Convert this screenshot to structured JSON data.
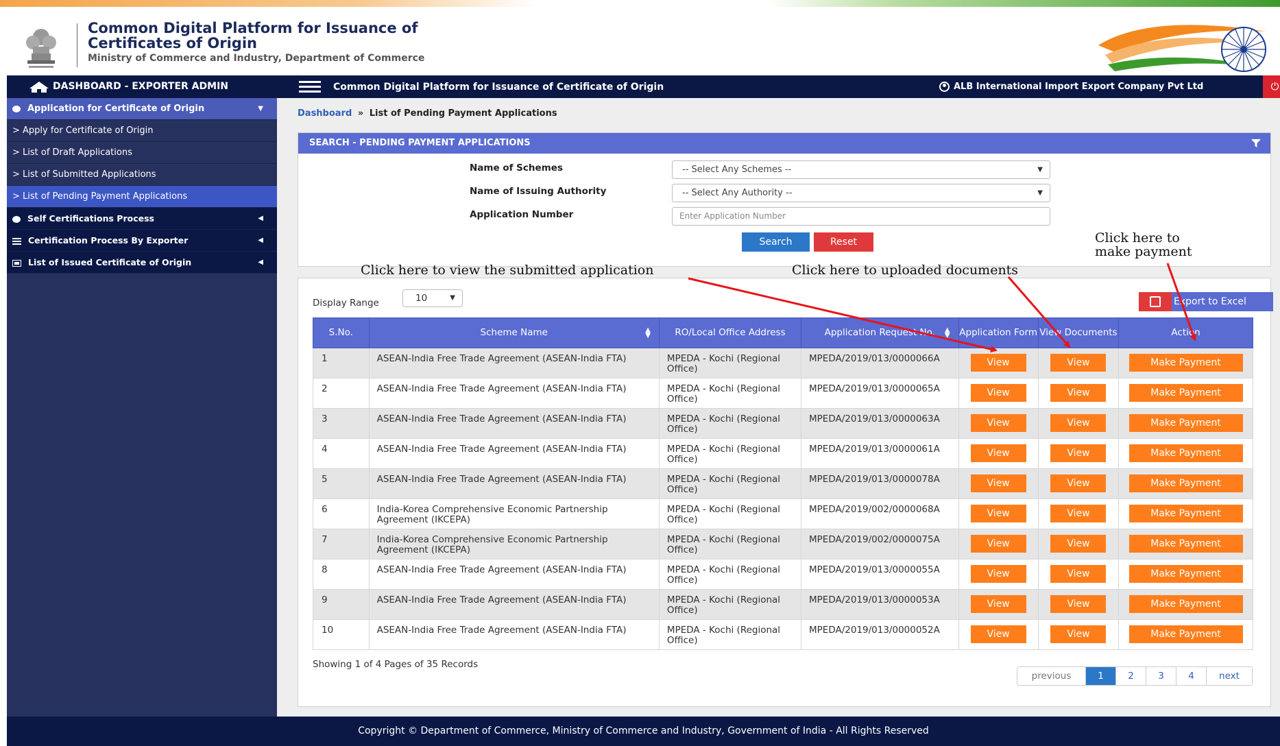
{
  "header": {
    "title_line1": "Common Digital Platform for Issuance of",
    "title_line2": "Certificates of Origin",
    "subtitle": "Ministry of Commerce and Industry, Department of Commerce"
  },
  "nav": {
    "brand": "DASHBOARD - EXPORTER ADMIN",
    "title": "Common Digital Platform for Issuance of Certificate of Origin",
    "user": "ALB International Import Export Company Pvt Ltd"
  },
  "sidebar": {
    "items": [
      {
        "label": "Application for Certificate of Origin"
      },
      {
        "label": "> Apply for Certificate of Origin"
      },
      {
        "label": "> List of Draft Applications"
      },
      {
        "label": "> List of Submitted Applications"
      },
      {
        "label": "> List of Pending Payment Applications"
      },
      {
        "label": "Self Certifications Process"
      },
      {
        "label": "Certification Process By Exporter"
      },
      {
        "label": "List of Issued Certificate of Origin"
      }
    ]
  },
  "breadcrumb": {
    "home": "Dashboard",
    "sep": "»",
    "current": "List of Pending Payment Applications"
  },
  "search": {
    "title": "SEARCH - PENDING PAYMENT APPLICATIONS",
    "scheme_label": "Name of Schemes",
    "scheme_value": "-- Select Any Schemes --",
    "authority_label": "Name of Issuing Authority",
    "authority_value": "-- Select Any Authority --",
    "appno_label": "Application Number",
    "appno_placeholder": "Enter Application Number",
    "search_btn": "Search",
    "reset_btn": "Reset"
  },
  "list": {
    "display_range_label": "Display Range",
    "display_range_value": "10",
    "export_btn": "Export to Excel",
    "columns": [
      "S.No.",
      "Scheme Name",
      "RO/Local Office Address",
      "Application Request No.",
      "Application Form",
      "View Documents",
      "Action"
    ],
    "view_label": "View",
    "pay_label": "Make Payment",
    "rows": [
      {
        "sno": "1",
        "scheme": "ASEAN-India Free Trade Agreement (ASEAN-India FTA)",
        "office": "MPEDA - Kochi (Regional Office)",
        "req": "MPEDA/2019/013/0000066A"
      },
      {
        "sno": "2",
        "scheme": "ASEAN-India Free Trade Agreement (ASEAN-India FTA)",
        "office": "MPEDA - Kochi (Regional Office)",
        "req": "MPEDA/2019/013/0000065A"
      },
      {
        "sno": "3",
        "scheme": "ASEAN-India Free Trade Agreement (ASEAN-India FTA)",
        "office": "MPEDA - Kochi (Regional Office)",
        "req": "MPEDA/2019/013/0000063A"
      },
      {
        "sno": "4",
        "scheme": "ASEAN-India Free Trade Agreement (ASEAN-India FTA)",
        "office": "MPEDA - Kochi (Regional Office)",
        "req": "MPEDA/2019/013/0000061A"
      },
      {
        "sno": "5",
        "scheme": "ASEAN-India Free Trade Agreement (ASEAN-India FTA)",
        "office": "MPEDA - Kochi (Regional Office)",
        "req": "MPEDA/2019/013/0000078A"
      },
      {
        "sno": "6",
        "scheme": "India-Korea Comprehensive Economic Partnership Agreement (IKCEPA)",
        "office": "MPEDA - Kochi (Regional Office)",
        "req": "MPEDA/2019/002/0000068A"
      },
      {
        "sno": "7",
        "scheme": "India-Korea Comprehensive Economic Partnership Agreement (IKCEPA)",
        "office": "MPEDA - Kochi (Regional Office)",
        "req": "MPEDA/2019/002/0000075A"
      },
      {
        "sno": "8",
        "scheme": "ASEAN-India Free Trade Agreement (ASEAN-India FTA)",
        "office": "MPEDA - Kochi (Regional Office)",
        "req": "MPEDA/2019/013/0000055A"
      },
      {
        "sno": "9",
        "scheme": "ASEAN-India Free Trade Agreement (ASEAN-India FTA)",
        "office": "MPEDA - Kochi (Regional Office)",
        "req": "MPEDA/2019/013/0000053A"
      },
      {
        "sno": "10",
        "scheme": "ASEAN-India Free Trade Agreement (ASEAN-India FTA)",
        "office": "MPEDA - Kochi (Regional Office)",
        "req": "MPEDA/2019/013/0000052A"
      }
    ],
    "showing": "Showing 1 of 4 Pages of 35 Records",
    "pagination": {
      "previous": "previous",
      "pages": [
        "1",
        "2",
        "3",
        "4"
      ],
      "next": "next"
    }
  },
  "annotations": {
    "view_app": "Click here to view the submitted application",
    "view_docs": "Click here to uploaded documents",
    "make_payment_line1": "Click here to",
    "make_payment_line2": "make payment"
  },
  "footer": {
    "copyright": "Copyright © Department of Commerce, Ministry of Commerce and Industry, Government of India - All Rights Reserved"
  },
  "colors": {
    "nav_bg": "#0b1846",
    "sidebar_bg": "#27315e",
    "panel_head": "#5a6bd1",
    "action_orange": "#ff7e1b",
    "search_blue": "#2b77c8",
    "reset_red": "#e0393c",
    "arrow_red": "#e8141a"
  }
}
